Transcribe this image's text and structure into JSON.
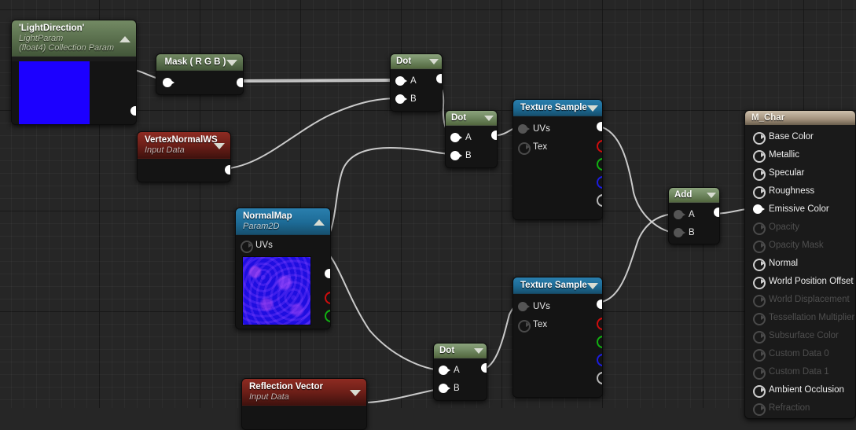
{
  "app": {
    "title": "Unreal Engine Material Editor Graph",
    "background_color": "#262626",
    "wire_color": "#d8d8d8"
  },
  "nodes": [
    {
      "id": "light_direction",
      "title": "'LightDirection'",
      "subtitle_line1": "LightParam",
      "subtitle_line2": "(float4) Collection Param",
      "header_color": "#5d7350",
      "caret": "up",
      "preview_color": "#1c00ff",
      "outputs": [
        {
          "label": "",
          "state": "filled"
        }
      ]
    },
    {
      "id": "mask_rgb",
      "title": "Mask ( R G B )",
      "header_color": "#5d7350",
      "caret": "down",
      "inputs": [
        {
          "label": "",
          "state": "filled"
        }
      ],
      "outputs": [
        {
          "label": "",
          "state": "filled"
        }
      ]
    },
    {
      "id": "vertex_normal_ws",
      "title": "VertexNormalWS",
      "subtitle_line1": "Input Data",
      "header_color": "#6d1f18",
      "caret": "down",
      "outputs": [
        {
          "label": "",
          "state": "filled"
        }
      ]
    },
    {
      "id": "dot_1",
      "title": "Dot",
      "header_color": "#6f8760",
      "caret": "down",
      "inputs": [
        {
          "label": "A",
          "state": "filled"
        },
        {
          "label": "B",
          "state": "filled"
        }
      ],
      "outputs": [
        {
          "label": "",
          "state": "filled"
        }
      ]
    },
    {
      "id": "dot_2",
      "title": "Dot",
      "header_color": "#6f8760",
      "caret": "down",
      "inputs": [
        {
          "label": "A",
          "state": "filled"
        },
        {
          "label": "B",
          "state": "filled"
        }
      ],
      "outputs": [
        {
          "label": "",
          "state": "filled"
        }
      ]
    },
    {
      "id": "dot_3",
      "title": "Dot",
      "header_color": "#6f8760",
      "caret": "down",
      "inputs": [
        {
          "label": "A",
          "state": "filled"
        },
        {
          "label": "B",
          "state": "filled"
        }
      ],
      "outputs": [
        {
          "label": "",
          "state": "filled"
        }
      ]
    },
    {
      "id": "normal_map",
      "title": "NormalMap",
      "subtitle_line1": "Param2D",
      "header_color": "#1d6b96",
      "caret": "up",
      "inputs": [
        {
          "label": "UVs",
          "state": "hollow-off"
        }
      ],
      "outputs": [
        {
          "label": "",
          "state": "filled"
        },
        {
          "label": "",
          "state": "red"
        },
        {
          "label": "",
          "state": "green"
        },
        {
          "label": "",
          "state": "blue"
        },
        {
          "label": "",
          "state": "alpha"
        }
      ]
    },
    {
      "id": "texture_sample_1",
      "title": "Texture Sample",
      "header_color": "#1d6b96",
      "caret": "down",
      "inputs": [
        {
          "label": "UVs",
          "state": "dim"
        },
        {
          "label": "Tex",
          "state": "hollow-off"
        }
      ],
      "outputs": [
        {
          "label": "",
          "state": "filled"
        },
        {
          "label": "",
          "state": "red"
        },
        {
          "label": "",
          "state": "green"
        },
        {
          "label": "",
          "state": "blue"
        },
        {
          "label": "",
          "state": "alpha"
        }
      ]
    },
    {
      "id": "texture_sample_2",
      "title": "Texture Sample",
      "header_color": "#1d6b96",
      "caret": "down",
      "inputs": [
        {
          "label": "UVs",
          "state": "dim"
        },
        {
          "label": "Tex",
          "state": "hollow-off"
        }
      ],
      "outputs": [
        {
          "label": "",
          "state": "filled"
        },
        {
          "label": "",
          "state": "red"
        },
        {
          "label": "",
          "state": "green"
        },
        {
          "label": "",
          "state": "blue"
        },
        {
          "label": "",
          "state": "alpha"
        }
      ]
    },
    {
      "id": "add",
      "title": "Add",
      "header_color": "#6f8760",
      "caret": "down",
      "inputs": [
        {
          "label": "A",
          "state": "dim"
        },
        {
          "label": "B",
          "state": "dim"
        }
      ],
      "outputs": [
        {
          "label": "",
          "state": "filled"
        }
      ]
    },
    {
      "id": "reflection_vector",
      "title": "Reflection Vector",
      "subtitle_line1": "Input Data",
      "header_color": "#6d1f18",
      "caret": "down"
    }
  ],
  "result_node": {
    "title": "M_Char",
    "header_color": "#a2917c",
    "pins": [
      {
        "label": "Base Color",
        "enabled": true,
        "connected": false
      },
      {
        "label": "Metallic",
        "enabled": true,
        "connected": false
      },
      {
        "label": "Specular",
        "enabled": true,
        "connected": false
      },
      {
        "label": "Roughness",
        "enabled": true,
        "connected": false
      },
      {
        "label": "Emissive Color",
        "enabled": true,
        "connected": true
      },
      {
        "label": "Opacity",
        "enabled": false,
        "connected": false
      },
      {
        "label": "Opacity Mask",
        "enabled": false,
        "connected": false
      },
      {
        "label": "Normal",
        "enabled": true,
        "connected": false
      },
      {
        "label": "World Position Offset",
        "enabled": true,
        "connected": false
      },
      {
        "label": "World Displacement",
        "enabled": false,
        "connected": false
      },
      {
        "label": "Tessellation Multiplier",
        "enabled": false,
        "connected": false
      },
      {
        "label": "Subsurface Color",
        "enabled": false,
        "connected": false
      },
      {
        "label": "Custom Data 0",
        "enabled": false,
        "connected": false
      },
      {
        "label": "Custom Data 1",
        "enabled": false,
        "connected": false
      },
      {
        "label": "Ambient Occlusion",
        "enabled": true,
        "connected": false
      },
      {
        "label": "Refraction",
        "enabled": false,
        "connected": false
      }
    ]
  },
  "node_labels": {
    "light_direction_title": "'LightDirection'",
    "light_direction_sub1": "LightParam",
    "light_direction_sub2": "(float4) Collection Param",
    "mask_title": "Mask ( R G B )",
    "vertex_normal_title": "VertexNormalWS",
    "vertex_normal_sub": "Input Data",
    "dot_title": "Dot",
    "normal_map_title": "NormalMap",
    "normal_map_sub": "Param2D",
    "texture_sample_title": "Texture Sample",
    "add_title": "Add",
    "reflection_title": "Reflection Vector",
    "reflection_sub": "Input Data",
    "pin_a": "A",
    "pin_b": "B",
    "pin_uvs": "UVs",
    "pin_tex": "Tex"
  }
}
